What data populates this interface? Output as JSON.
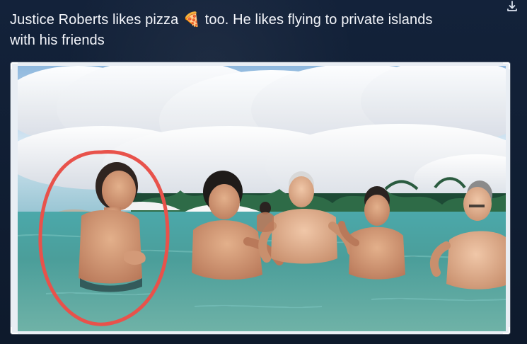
{
  "post": {
    "line1_part1": "Justice Roberts likes pizza",
    "emoji": "🍕",
    "line1_part2": " too.  He likes flying to private islands",
    "line2": "with his friends"
  },
  "icons": {
    "download": "download-icon",
    "pizza": "pizza-emoji"
  },
  "colors": {
    "background": "#0f1a2a",
    "text": "#f4f6fb",
    "highlight_circle": "#e8524b"
  }
}
